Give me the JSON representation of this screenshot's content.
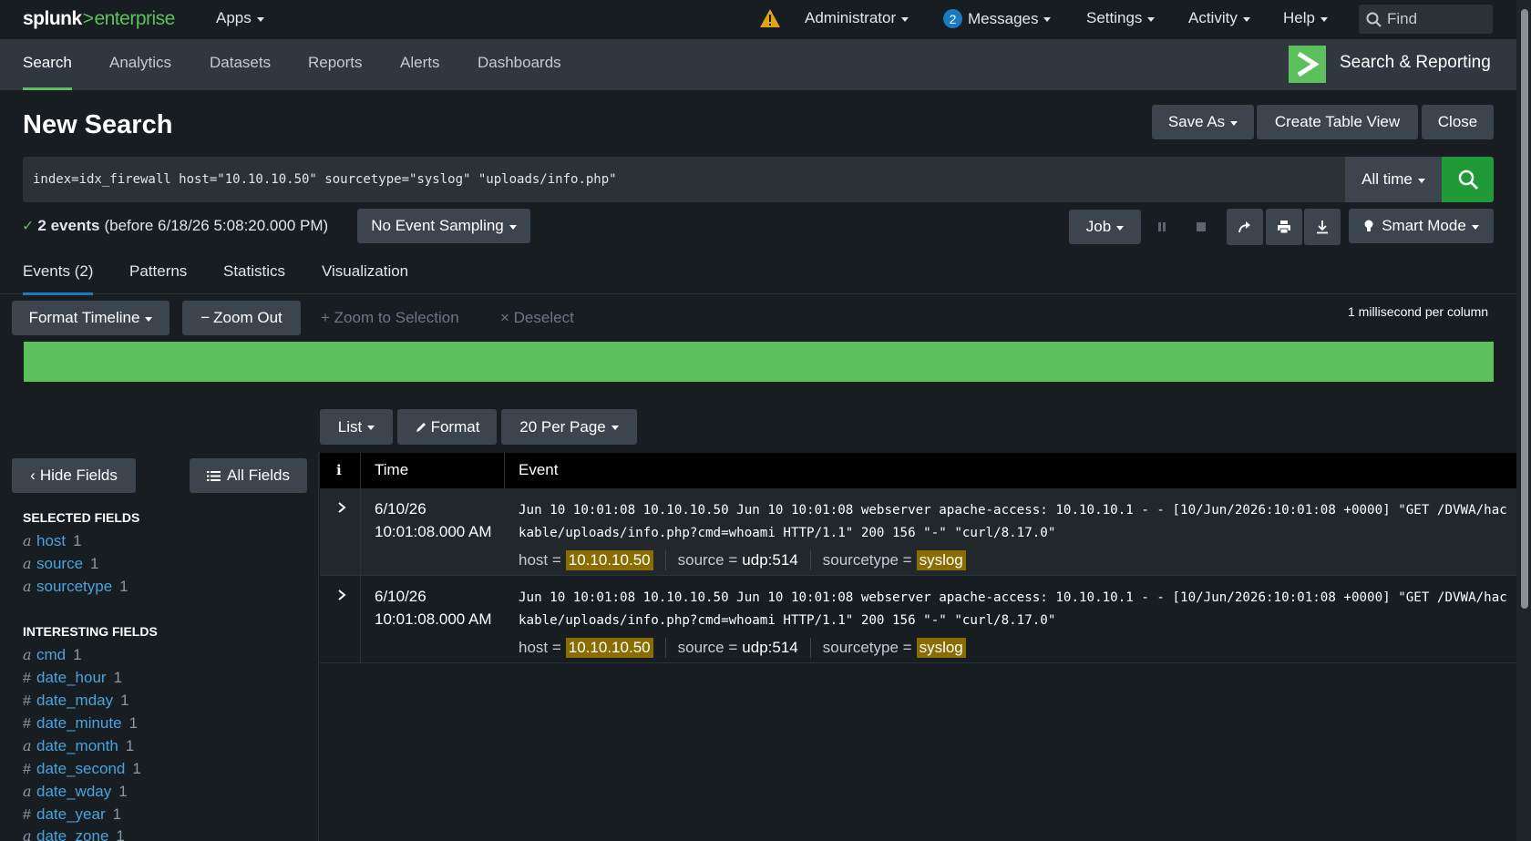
{
  "topbar": {
    "logo_main": "splunk",
    "logo_gt": ">",
    "logo_sub": "enterprise",
    "apps": "Apps",
    "admin": "Administrator",
    "messages_count": "2",
    "messages": "Messages",
    "settings": "Settings",
    "activity": "Activity",
    "help": "Help",
    "find": "Find"
  },
  "appbar": {
    "tabs": [
      "Search",
      "Analytics",
      "Datasets",
      "Reports",
      "Alerts",
      "Dashboards"
    ],
    "app_title": "Search & Reporting"
  },
  "header": {
    "title": "New Search",
    "save_as": "Save As",
    "create_table": "Create Table View",
    "close": "Close"
  },
  "search": {
    "query": "index=idx_firewall host=\"10.10.10.50\" sourcetype=\"syslog\" \"uploads/info.php\"",
    "time_range": "All time"
  },
  "status": {
    "count": "2 events",
    "detail": "(before 6/18/26 5:08:20.000 PM)",
    "sampling": "No Event Sampling",
    "job": "Job",
    "mode": "Smart Mode"
  },
  "tabs": [
    "Events (2)",
    "Patterns",
    "Statistics",
    "Visualization"
  ],
  "timeline": {
    "format": "Format Timeline",
    "zoom_out": "Zoom Out",
    "zoom_selection": "Zoom to Selection",
    "deselect": "Deselect",
    "scale": "1 millisecond per column"
  },
  "results_toolbar": {
    "list": "List",
    "format": "Format",
    "per_page": "20 Per Page"
  },
  "fields": {
    "hide": "Hide Fields",
    "all": "All Fields",
    "selected_title": "SELECTED FIELDS",
    "selected": [
      {
        "type": "a",
        "name": "host",
        "count": "1"
      },
      {
        "type": "a",
        "name": "source",
        "count": "1"
      },
      {
        "type": "a",
        "name": "sourcetype",
        "count": "1"
      }
    ],
    "interesting_title": "INTERESTING FIELDS",
    "interesting": [
      {
        "type": "a",
        "name": "cmd",
        "count": "1"
      },
      {
        "type": "#",
        "name": "date_hour",
        "count": "1"
      },
      {
        "type": "#",
        "name": "date_mday",
        "count": "1"
      },
      {
        "type": "#",
        "name": "date_minute",
        "count": "1"
      },
      {
        "type": "a",
        "name": "date_month",
        "count": "1"
      },
      {
        "type": "#",
        "name": "date_second",
        "count": "1"
      },
      {
        "type": "a",
        "name": "date_wday",
        "count": "1"
      },
      {
        "type": "#",
        "name": "date_year",
        "count": "1"
      },
      {
        "type": "a",
        "name": "date_zone",
        "count": "1"
      }
    ]
  },
  "table": {
    "col_info": "i",
    "col_time": "Time",
    "col_event": "Event",
    "rows": [
      {
        "date": "6/10/26",
        "time": "10:01:08.000 AM",
        "raw": "Jun 10 10:01:08 10.10.10.50 Jun 10 10:01:08 webserver apache-access: 10.10.10.1 - - [10/Jun/2026:10:01:08 +0000] \"GET /DVWA/hackable/uploads/info.php?cmd=whoami HTTP/1.1\" 200 156 \"-\" \"curl/8.17.0\"",
        "host_label": "host =",
        "host": "10.10.10.50",
        "source_label": "source =",
        "source": "udp:514",
        "sourcetype_label": "sourcetype =",
        "sourcetype": "syslog"
      },
      {
        "date": "6/10/26",
        "time": "10:01:08.000 AM",
        "raw": "Jun 10 10:01:08 10.10.10.50 Jun 10 10:01:08 webserver apache-access: 10.10.10.1 - - [10/Jun/2026:10:01:08 +0000] \"GET /DVWA/hackable/uploads/info.php?cmd=whoami HTTP/1.1\" 200 156 \"-\" \"curl/8.17.0\"",
        "host_label": "host =",
        "host": "10.10.10.50",
        "source_label": "source =",
        "source": "udp:514",
        "sourcetype_label": "sourcetype =",
        "sourcetype": "syslog"
      }
    ]
  },
  "colors": {
    "accent_green": "#5cc05c",
    "search_green": "#1f9a37",
    "link_blue": "#4aa3df",
    "highlight": "#8a6d00"
  }
}
